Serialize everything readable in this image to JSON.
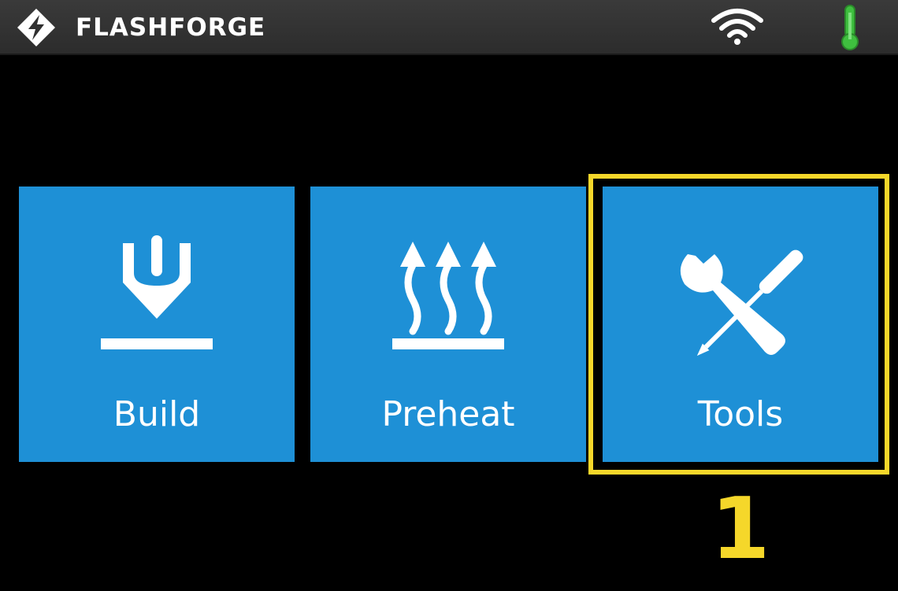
{
  "header": {
    "brand": "FLASHFORGE",
    "logo_icon": "flashforge-logo-icon",
    "wifi_icon": "wifi-icon",
    "temperature_icon": "thermometer-icon",
    "temperature_color": "#3fbf3f"
  },
  "menu": {
    "tiles": [
      {
        "label": "Build",
        "icon": "build-icon"
      },
      {
        "label": "Preheat",
        "icon": "heat-icon"
      },
      {
        "label": "Tools",
        "icon": "tools-icon"
      }
    ],
    "tile_color": "#1e90d6"
  },
  "annotation": {
    "step_number": "1",
    "color": "#f5d72a",
    "highlighted_tile": "Tools"
  }
}
